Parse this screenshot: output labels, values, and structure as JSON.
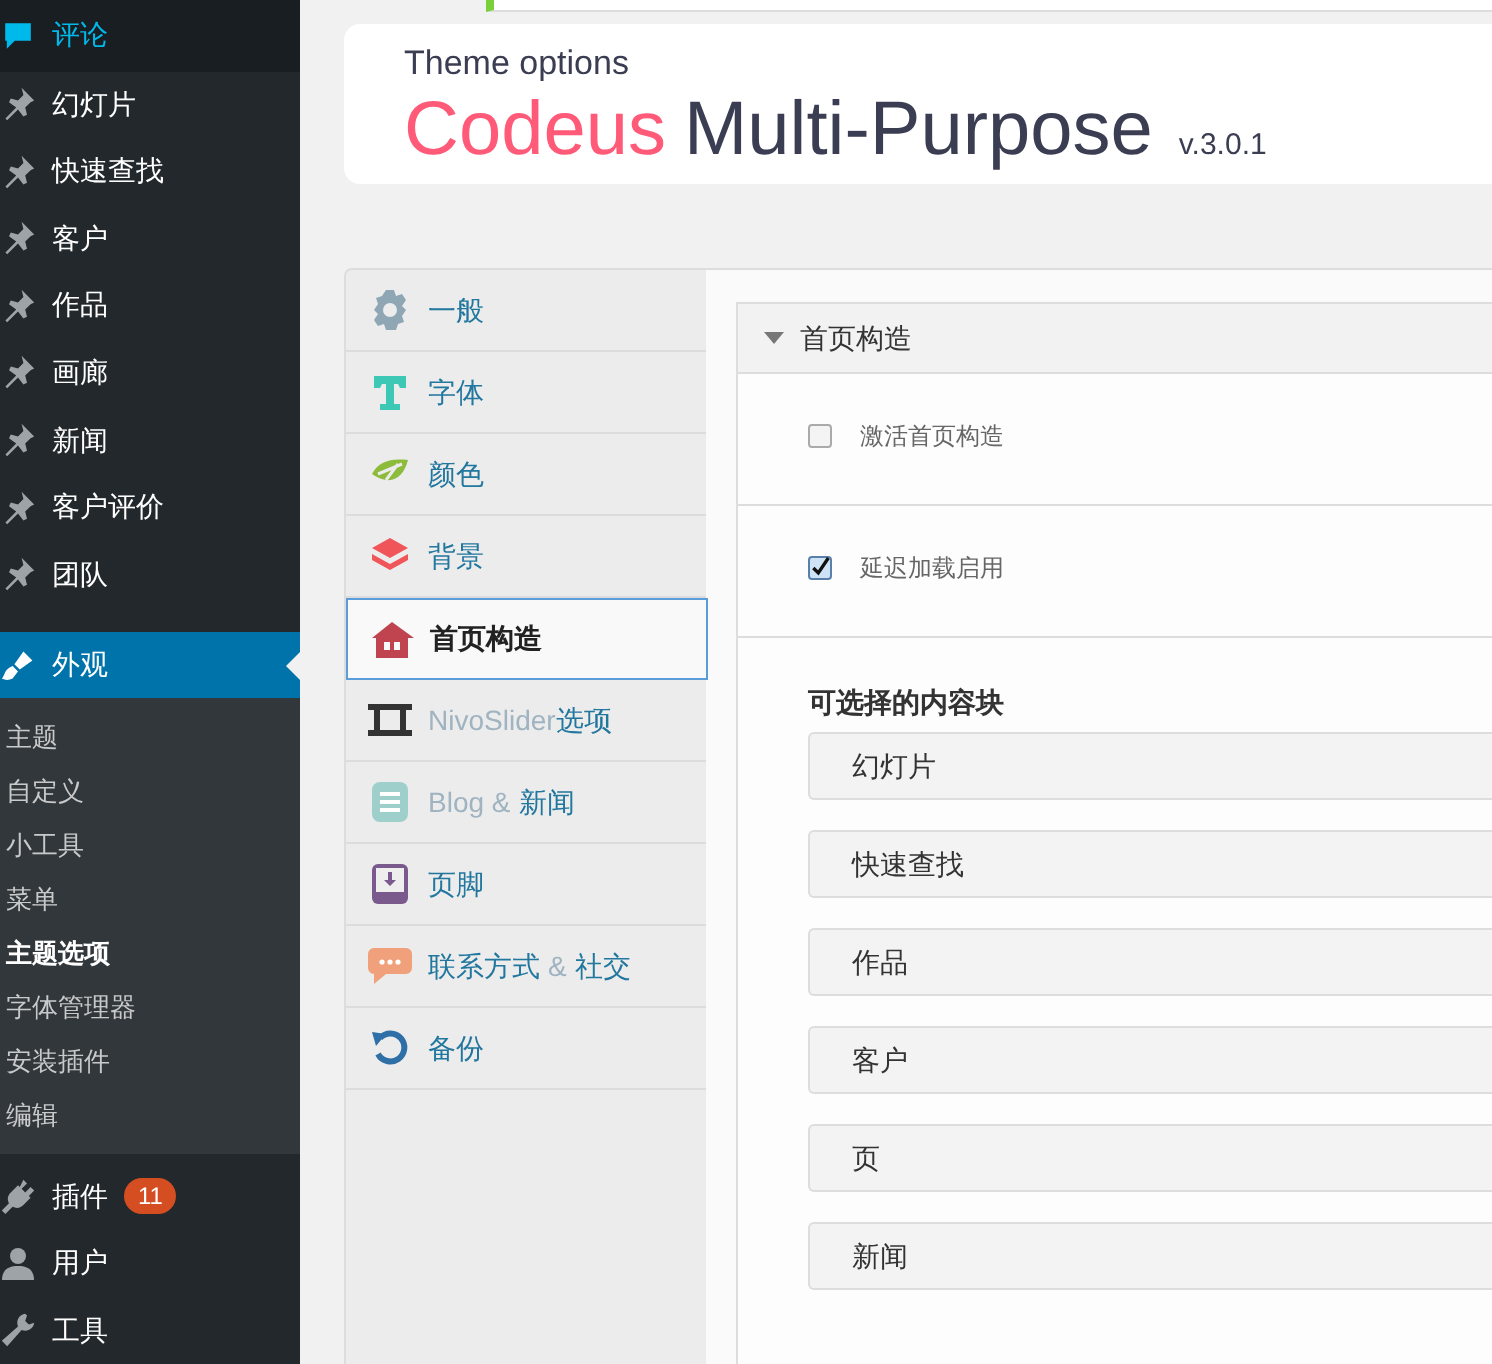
{
  "sidebar": {
    "items": [
      {
        "label": "评论",
        "kind": "comment",
        "selected": false,
        "highlighted": true
      },
      {
        "label": "幻灯片",
        "kind": "pin",
        "selected": false
      },
      {
        "label": "快速查找",
        "kind": "pin",
        "selected": false
      },
      {
        "label": "客户",
        "kind": "pin",
        "selected": false
      },
      {
        "label": "作品",
        "kind": "pin",
        "selected": false
      },
      {
        "label": "画廊",
        "kind": "pin",
        "selected": false
      },
      {
        "label": "新闻",
        "kind": "pin",
        "selected": false
      },
      {
        "label": "客户评价",
        "kind": "pin",
        "selected": false
      },
      {
        "label": "团队",
        "kind": "pin",
        "selected": false
      },
      {
        "label": "外观",
        "kind": "brush",
        "selected": true,
        "children": [
          {
            "label": "主题",
            "selected": false
          },
          {
            "label": "自定义",
            "selected": false
          },
          {
            "label": "小工具",
            "selected": false
          },
          {
            "label": "菜单",
            "selected": false
          },
          {
            "label": "主题选项",
            "selected": true
          },
          {
            "label": "字体管理器",
            "selected": false
          },
          {
            "label": "安装插件",
            "selected": false
          },
          {
            "label": "编辑",
            "selected": false
          }
        ]
      },
      {
        "label": "插件",
        "kind": "plug",
        "selected": false,
        "badge": "11"
      },
      {
        "label": "用户",
        "kind": "user",
        "selected": false
      },
      {
        "label": "工具",
        "kind": "wrench",
        "selected": false
      }
    ]
  },
  "header": {
    "subtitle": "Theme options",
    "brand": "Codeus",
    "product": "Multi-Purpose",
    "version": "v.3.0.1"
  },
  "tabs": [
    {
      "parts": [
        {
          "text": "一般",
          "muted": false
        }
      ],
      "kind": "gear",
      "selected": false
    },
    {
      "parts": [
        {
          "text": "字体",
          "muted": false
        }
      ],
      "kind": "font",
      "selected": false
    },
    {
      "parts": [
        {
          "text": "颜色",
          "muted": false
        }
      ],
      "kind": "palette",
      "selected": false
    },
    {
      "parts": [
        {
          "text": "背景",
          "muted": false
        }
      ],
      "kind": "layers",
      "selected": false
    },
    {
      "parts": [
        {
          "text": "首页构造",
          "muted": false
        }
      ],
      "kind": "house",
      "selected": true
    },
    {
      "parts": [
        {
          "text": "NivoSlider",
          "muted": true
        },
        {
          "text": "选项",
          "muted": false
        }
      ],
      "kind": "film",
      "selected": false
    },
    {
      "parts": [
        {
          "text": "Blog &",
          "muted": true
        },
        {
          "text": "新闻",
          "muted": false
        }
      ],
      "kind": "doc",
      "selected": false
    },
    {
      "parts": [
        {
          "text": "页脚",
          "muted": false
        }
      ],
      "kind": "footer",
      "selected": false
    },
    {
      "parts": [
        {
          "text": "联系方式",
          "muted": false
        },
        {
          "text": "&",
          "muted": true
        },
        {
          "text": "社交",
          "muted": false
        }
      ],
      "kind": "chat",
      "selected": false
    },
    {
      "parts": [
        {
          "text": "备份",
          "muted": false
        }
      ],
      "kind": "undo",
      "selected": false
    }
  ],
  "section": {
    "title": "首页构造",
    "expanded": true,
    "options": [
      {
        "label": "激活首页构造",
        "checked": false
      },
      {
        "label": "延迟加载启用",
        "checked": true
      }
    ],
    "blocks_title": "可选择的内容块",
    "blocks": [
      "幻灯片",
      "快速查找",
      "作品",
      "客户",
      "页",
      "新闻"
    ]
  }
}
